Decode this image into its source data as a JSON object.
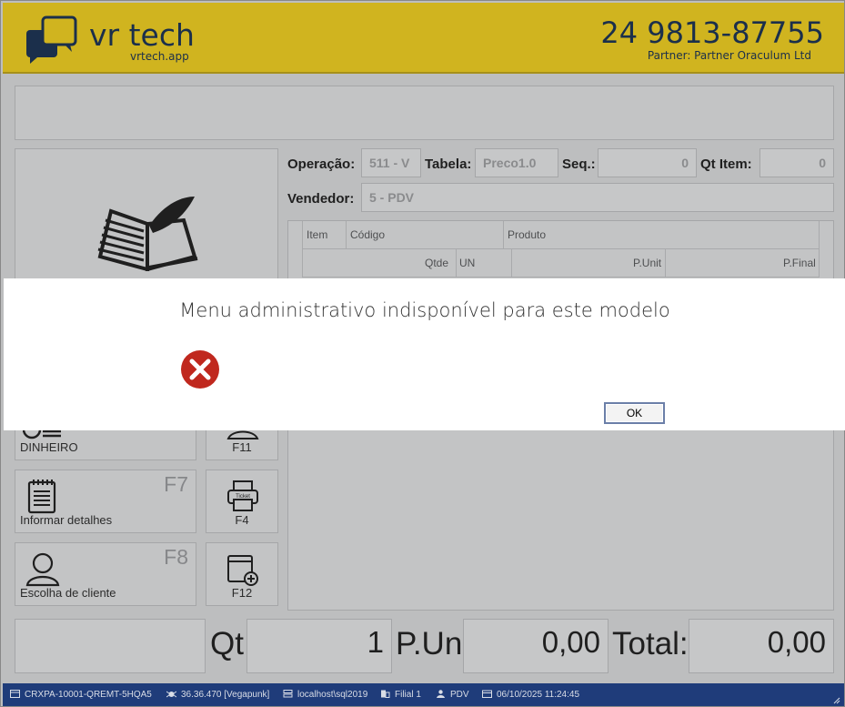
{
  "header": {
    "brand": "vr tech",
    "brand_sub": "vrtech.app",
    "phone": "24 9813-87755",
    "partner": "Partner: Partner Oraculum Ltd"
  },
  "form": {
    "operacao_label": "Operação:",
    "operacao_value": "511 - V",
    "tabela_label": "Tabela:",
    "tabela_value": "Preco1.0",
    "seq_label": "Seq.:",
    "seq_value": "0",
    "qtitem_label": "Qt Item:",
    "qtitem_value": "0",
    "vendedor_label": "Vendedor:",
    "vendedor_value": "5 - PDV"
  },
  "grid": {
    "row1": [
      "Item",
      "Código",
      "Produto"
    ],
    "row2": [
      "Qtde",
      "UN",
      "P.Unit",
      "P.Final"
    ]
  },
  "buttons": {
    "dinheiro": "DINHEIRO",
    "f11": "F11",
    "informar_label": "Informar detalhes",
    "informar_key": "F7",
    "ticket_icon_text": "Ticket",
    "f4": "F4",
    "cliente_label": "Escolha de cliente",
    "cliente_key": "F8",
    "f12": "F12"
  },
  "totals": {
    "qt_label": "Qt",
    "qt_value": "1",
    "pun_label": "P.Un",
    "pun_value": "0,00",
    "total_label": "Total:",
    "total_value": "0,00"
  },
  "status": {
    "terminal": "CRXPA-10001-QREMT-5HQA5",
    "version": "36.36.470 [Vegapunk]",
    "server": "localhost\\sql2019",
    "filial": "Filial 1",
    "user": "PDV",
    "datetime": "06/10/2025 11:24:45"
  },
  "dialog": {
    "message": "Menu administrativo indisponível para este modelo",
    "ok_label": "OK"
  },
  "colors": {
    "header_bg": "#d0b41f",
    "brand_text": "#1b2f4b",
    "status_bg": "#1f3c7a",
    "error_red": "#c0281e"
  }
}
